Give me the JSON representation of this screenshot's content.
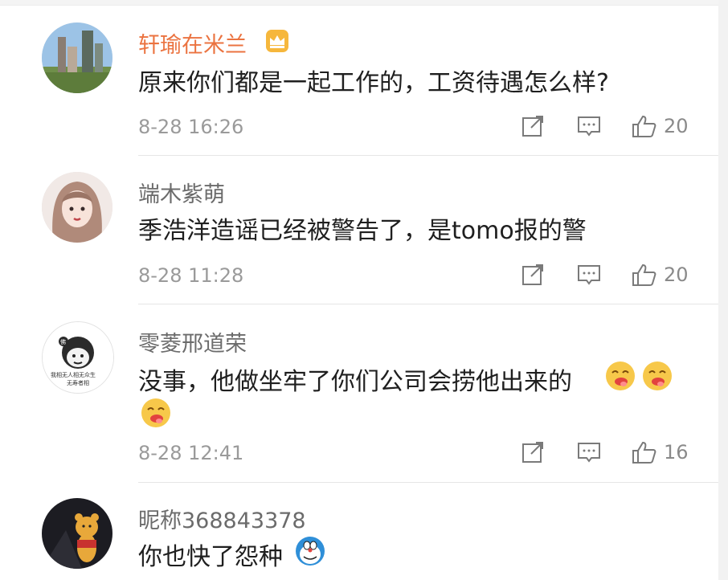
{
  "comments": [
    {
      "name": "轩瑜在米兰",
      "vip": true,
      "text": "原来你们都是一起工作的，工资待遇怎么样?",
      "time": "8-28 16:26",
      "likes": "20",
      "avatar": "city-avatar"
    },
    {
      "name": "端木紫萌",
      "vip": false,
      "text": "季浩洋造谣已经被警告了，是tomo报的警",
      "time": "8-28 11:28",
      "likes": "20",
      "avatar": "anime-girl-avatar"
    },
    {
      "name": "零菱邢道荣",
      "vip": false,
      "text": "没事，他做坐牢了你们公司会捞他出来的",
      "time": "8-28 12:41",
      "likes": "16",
      "avatar": "meme-face-avatar",
      "avatar_text_top": "佛",
      "avatar_text_line1": "我相无人相无众生",
      "avatar_text_line2": "无寿者相"
    },
    {
      "name": "昵称368843378",
      "vip": false,
      "text": "你也快了怨种",
      "avatar": "bear-avatar"
    }
  ],
  "icons": {
    "share": "share-icon",
    "reply": "comment-icon",
    "like": "thumbs-up-icon",
    "vip": "crown-badge-icon",
    "emoji_drool": "drooling-face-emoji",
    "emoji_doraemon": "doraemon-emoji"
  },
  "colors": {
    "vip_name": "#eb7340",
    "name": "#6b6b6b",
    "meta": "#9a9a9a"
  }
}
